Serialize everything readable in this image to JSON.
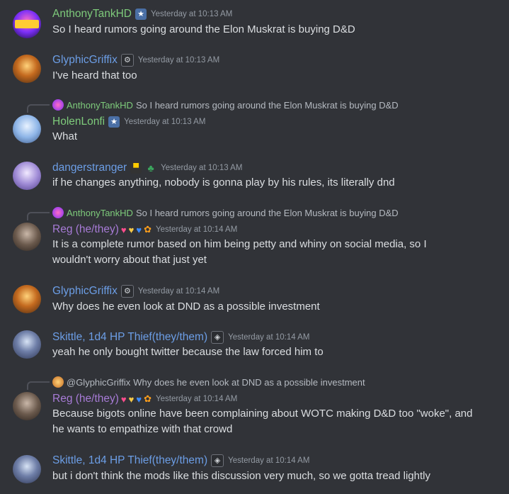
{
  "colors": {
    "background": "#313338",
    "text": "#dbdee1",
    "timestamp": "#949ba4",
    "green_name": "#7ecb7b",
    "blue_name": "#6c9ee6",
    "purple_name": "#a77bd6"
  },
  "messages": [
    {
      "author": "AnthonyTankHD",
      "timestamp": "Yesterday at 10:13 AM",
      "content": "So I heard rumors going around the Elon Muskrat is buying D&D"
    },
    {
      "author": "GlyphicGriffix",
      "timestamp": "Yesterday at 10:13 AM",
      "content": "I've heard that too"
    },
    {
      "reply_author": "AnthonyTankHD",
      "reply_text": "So I heard rumors going around the Elon Muskrat is buying D&D",
      "author": "HolenLonfi",
      "timestamp": "Yesterday at 10:13 AM",
      "content": "What"
    },
    {
      "author": "dangerstranger",
      "timestamp": "Yesterday at 10:13 AM",
      "content": "if he changes anything, nobody is gonna play by his rules, its literally dnd"
    },
    {
      "reply_author": "AnthonyTankHD",
      "reply_text": "So I heard rumors going around the Elon Muskrat is buying D&D",
      "author": "Reg (he/they)",
      "timestamp": "Yesterday at 10:14 AM",
      "content_line1": "It is a complete rumor based on him being petty and whiny on social media, so I",
      "content_line2": "wouldn't worry about that just yet"
    },
    {
      "author": "GlyphicGriffix",
      "timestamp": "Yesterday at 10:14 AM",
      "content": "Why does he even look at DND as a possible investment"
    },
    {
      "author": "Skittle, 1d4 HP Thief(they/them)",
      "timestamp": "Yesterday at 10:14 AM",
      "content": "yeah he only bought twitter because the law forced him to"
    },
    {
      "reply_author": "@GlyphicGriffix",
      "reply_text": "Why does he even look at DND as a possible investment",
      "author": "Reg (he/they)",
      "timestamp": "Yesterday at 10:14 AM",
      "content_line1": "Because bigots online have been complaining about WOTC making D&D too \"woke\", and",
      "content_line2": "he wants to empathize with that crowd"
    },
    {
      "author": "Skittle, 1d4 HP Thief(they/them)",
      "timestamp": "Yesterday at 10:14 AM",
      "content": "but i don't think the mods like this discussion very much, so we gotta tread lightly"
    }
  ]
}
